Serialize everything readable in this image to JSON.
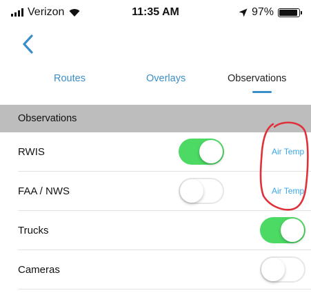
{
  "status_bar": {
    "carrier": "Verizon",
    "time": "11:35 AM",
    "battery": "97%",
    "battery_level": 0.97
  },
  "nav": {
    "back_icon": "chevron-left-icon"
  },
  "tabs": [
    {
      "label": "Routes",
      "active": false
    },
    {
      "label": "Overlays",
      "active": false
    },
    {
      "label": "Observations",
      "active": true
    }
  ],
  "section": {
    "title": "Observations"
  },
  "rows": [
    {
      "label": "RWIS",
      "toggle": "on",
      "link": "Air Temp"
    },
    {
      "label": "FAA / NWS",
      "toggle": "off",
      "link": "Air Temp"
    },
    {
      "label": "Trucks",
      "toggle": "on"
    },
    {
      "label": "Cameras",
      "toggle": "off"
    }
  ],
  "colors": {
    "accent": "#3a8ec9",
    "toggle_on": "#4cd964",
    "header_bg": "#bdbdbd",
    "annotation": "#e0303a"
  }
}
